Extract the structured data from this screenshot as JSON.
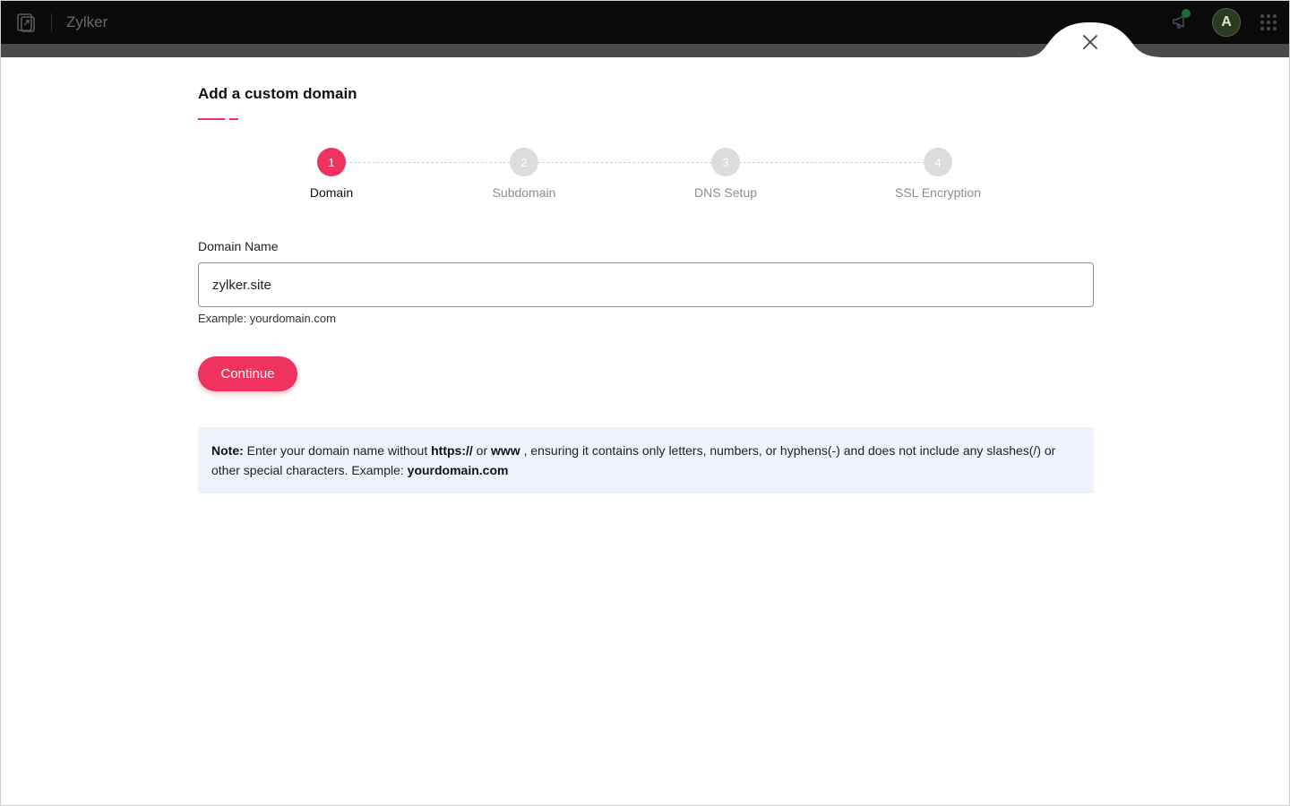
{
  "header": {
    "brand_name": "Zylker",
    "avatar_initial": "A",
    "icons": {
      "logo": "app-logo-icon",
      "announcement": "megaphone-icon",
      "apps": "grid-apps-icon",
      "close": "close-icon"
    },
    "colors": {
      "bar": "#0a0a0b",
      "notification_dot": "#1f6b3a",
      "avatar_bg": "#2c3a22"
    }
  },
  "page": {
    "title": "Add a custom domain"
  },
  "stepper": {
    "active_index": 0,
    "steps": [
      {
        "number": "1",
        "label": "Domain"
      },
      {
        "number": "2",
        "label": "Subdomain"
      },
      {
        "number": "3",
        "label": "DNS Setup"
      },
      {
        "number": "4",
        "label": "SSL Encryption"
      }
    ]
  },
  "form": {
    "domain_label": "Domain Name",
    "domain_value": "zylker.site",
    "domain_hint": "Example: yourdomain.com",
    "continue_label": "Continue"
  },
  "note": {
    "prefix": "Note:",
    "text_1": " Enter your domain name without ",
    "bold_1": "https://",
    "text_2": " or ",
    "bold_2": "www",
    "text_3": " , ensuring it contains only letters, numbers, or hyphens(-) and does not include any slashes(/) or other special characters. Example: ",
    "bold_3": "yourdomain.com"
  },
  "theme": {
    "accent": "#f0325f",
    "note_bg": "#edf2fd"
  }
}
